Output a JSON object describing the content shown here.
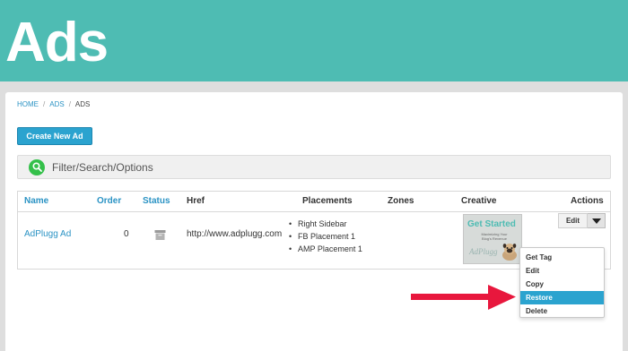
{
  "header": {
    "title": "Ads",
    "color": "#4ebcb3"
  },
  "breadcrumb": {
    "items": [
      "HOME",
      "ADS",
      "ADS"
    ],
    "separator": "/"
  },
  "toolbar": {
    "create_label": "Create New Ad"
  },
  "filter": {
    "label": "Filter/Search/Options",
    "icon": "search-icon"
  },
  "table": {
    "headers": {
      "name": "Name",
      "order": "Order",
      "status": "Status",
      "href": "Href",
      "placements": "Placements",
      "zones": "Zones",
      "creative": "Creative",
      "actions": "Actions"
    },
    "rows": [
      {
        "name": "AdPlugg Ad",
        "order": "0",
        "status_icon": "archive-icon",
        "href": "http://www.adplugg.com",
        "placements": [
          "Right Sidebar",
          "FB Placement 1",
          "AMP Placement 1"
        ],
        "zones": "",
        "creative": {
          "title": "Get Started",
          "subtitle": "Maximizing Your Blog's Revenue",
          "logo": "AdPlugg"
        },
        "edit_label": "Edit"
      }
    ]
  },
  "menu": {
    "items": [
      "Get Tag",
      "Edit",
      "Copy",
      "Restore",
      "Delete"
    ],
    "active_index": 3
  },
  "colors": {
    "accent": "#2ba3cf",
    "arrow": "#e8173d",
    "filter_icon": "#34c04a"
  }
}
